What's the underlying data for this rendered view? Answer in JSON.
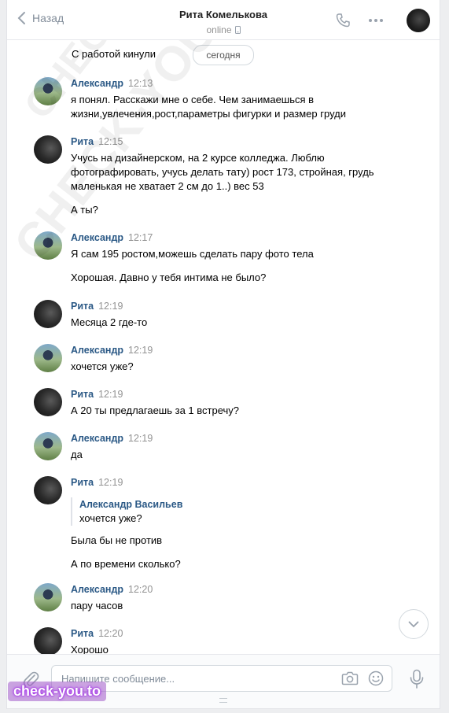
{
  "header": {
    "back_label": "Назад",
    "contact_name": "Рита Комелькова",
    "status": "online"
  },
  "feed": {
    "intro_text": "С работой кинули",
    "date_divider": "сегодня"
  },
  "messages": [
    {
      "author": "Александр",
      "time": "12:13",
      "lines": [
        "я понял. Расскажи мне о себе. Чем занимаешься в жизни,увлечения,рост,параметры фигурки и размер груди"
      ]
    },
    {
      "author": "Рита",
      "time": "12:15",
      "lines": [
        "Учусь на дизайнерском, на 2 курсе колледжа. Люблю фотографировать, учусь делать тату) рост 173, стройная, грудь маленькая не хватает 2 см до 1..) вес 53",
        "А ты?"
      ]
    },
    {
      "author": "Александр",
      "time": "12:17",
      "lines": [
        "Я сам 195 ростом,можешь сделать пару фото тела",
        "Хорошая. Давно у тебя интима не было?"
      ]
    },
    {
      "author": "Рита",
      "time": "12:19",
      "lines": [
        "Месяца 2 где-то"
      ]
    },
    {
      "author": "Александр",
      "time": "12:19",
      "lines": [
        "хочется уже?"
      ]
    },
    {
      "author": "Рита",
      "time": "12:19",
      "lines": [
        "А 20 ты предлагаешь за 1 встречу?"
      ]
    },
    {
      "author": "Александр",
      "time": "12:19",
      "lines": [
        "да"
      ]
    },
    {
      "author": "Рита",
      "time": "12:19",
      "quote": {
        "author": "Александр Васильев",
        "text": "хочется уже?"
      },
      "lines": [
        "Была бы не против",
        "А по времени сколько?"
      ]
    },
    {
      "author": "Александр",
      "time": "12:20",
      "lines": [
        "пару часов"
      ]
    },
    {
      "author": "Рита",
      "time": "12:20",
      "lines": [
        "Хорошо"
      ]
    }
  ],
  "composer": {
    "placeholder": "Напишите сообщение..."
  },
  "watermark": {
    "diagonal_1": "CHECK-YOU.ME",
    "diagonal_2": "CHECK-YOU.ME",
    "logo": "check-you.to"
  },
  "icons": {
    "back": "chevron-left-icon",
    "mobile": "mobile-phone-icon",
    "call": "phone-icon",
    "more": "more-dots-icon",
    "scroll_down": "chevron-down-icon",
    "attach": "paperclip-icon",
    "camera": "camera-icon",
    "emoji": "smile-icon",
    "mic": "microphone-icon"
  },
  "colors": {
    "link": "#2a5885",
    "muted": "#939393",
    "background": "#edeef0"
  }
}
